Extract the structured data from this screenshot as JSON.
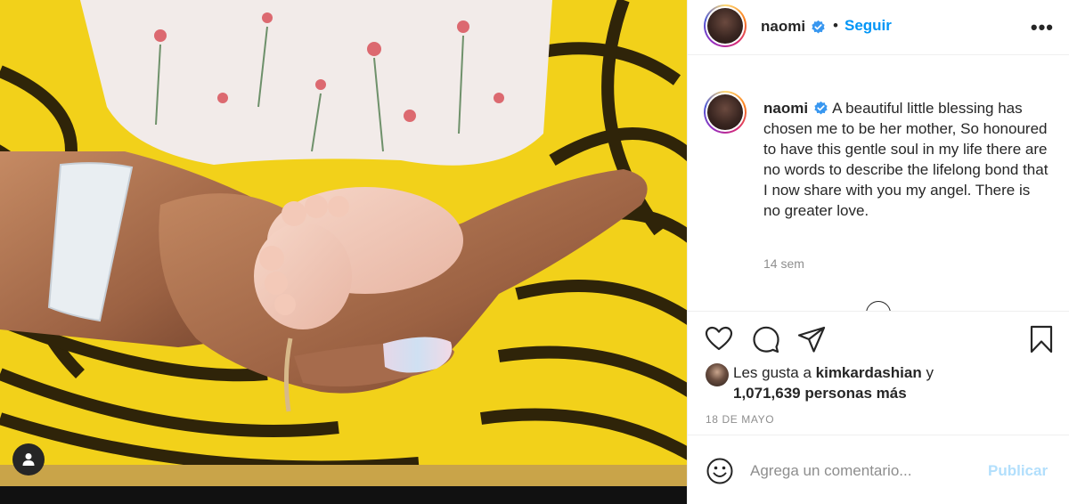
{
  "post": {
    "username": "naomi",
    "verified": true,
    "follow_label": "Seguir",
    "more_label": "•••",
    "caption_text": "A beautiful little blessing has chosen me to be her mother, So honoured to have this gentle soul in my life there are no words to describe the lifelong bond that I now share with you my angel. There is no greater love.",
    "time_ago": "14 sem",
    "likes": {
      "prefix": "Les gusta a",
      "liker": "kimkardashian",
      "joiner": "y",
      "others": "1,071,639 personas más"
    },
    "date": "18 DE MAYO"
  },
  "comment_box": {
    "placeholder": "Agrega un comentario...",
    "submit_label": "Publicar"
  },
  "icons": {
    "heart": "heart-icon",
    "comment": "comment-icon",
    "share": "paper-plane-icon",
    "save": "bookmark-icon",
    "emoji": "smiley-icon",
    "tag": "user-tag-icon",
    "verified": "verified-badge-icon"
  },
  "colors": {
    "accent": "#0095f6",
    "accent_disabled": "#b2dffc",
    "text": "#262626",
    "muted": "#8e8e8e",
    "verified": "#3897f0"
  }
}
